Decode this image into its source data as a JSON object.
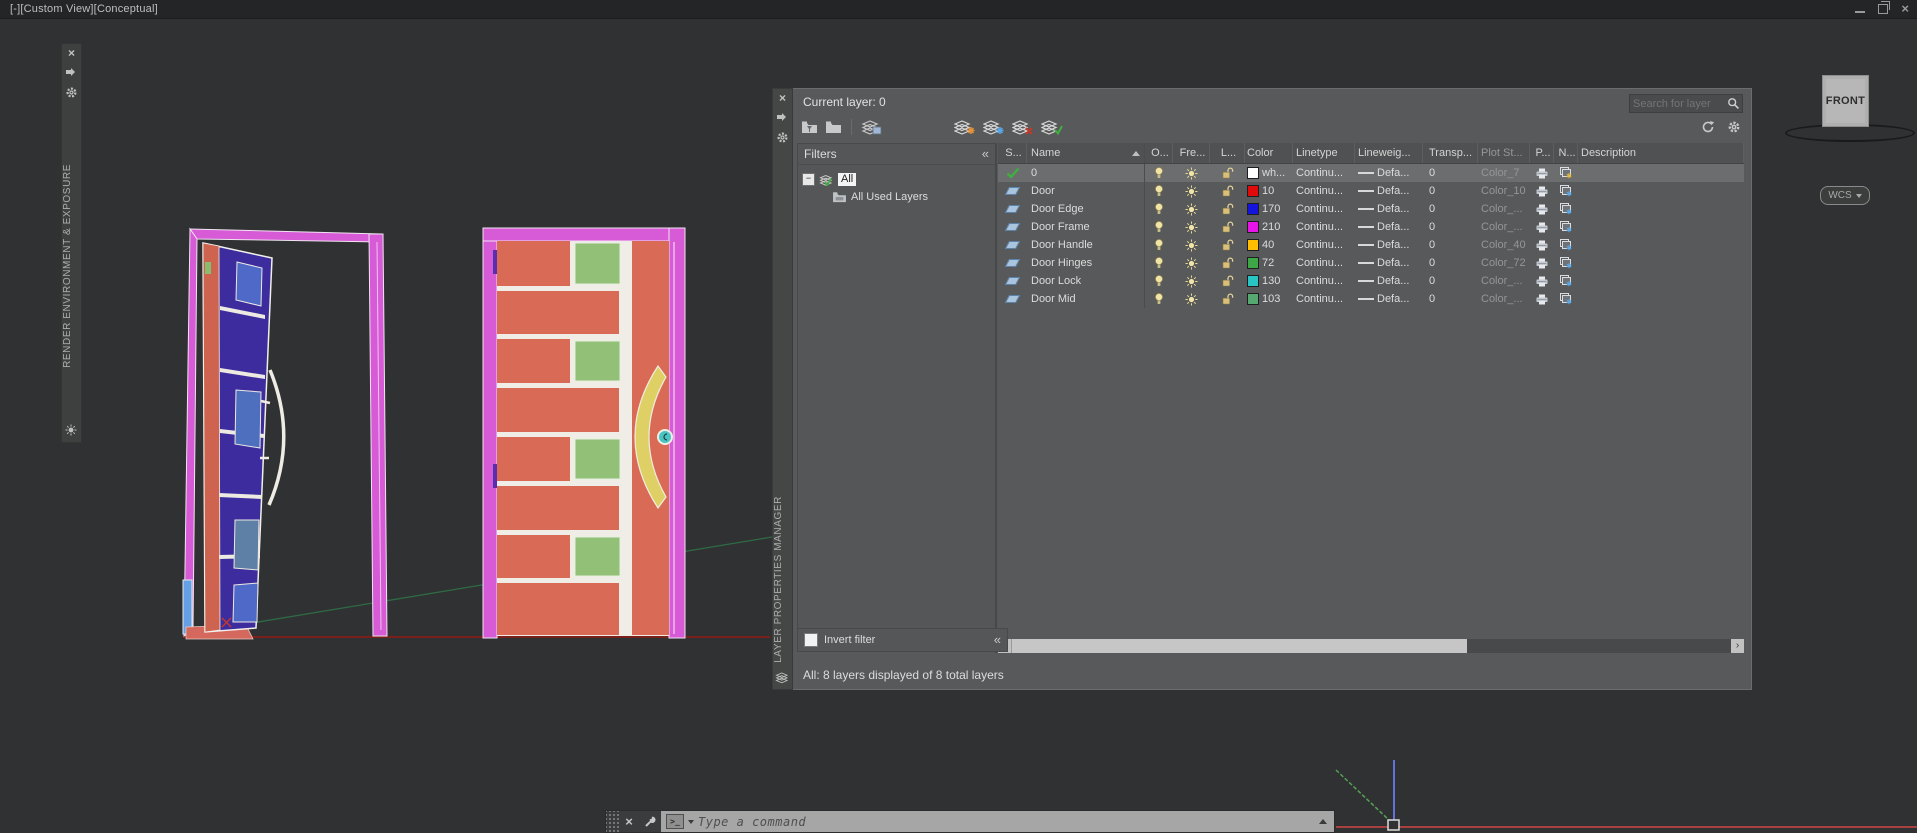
{
  "window": {
    "view_controls_label": "[-][Custom View][Conceptual]"
  },
  "viewport": {
    "left_toolbar_title": "RENDER ENVIRONMENT & EXPOSURE",
    "viewcube": {
      "face": "FRONT",
      "wcs_label": "WCS"
    }
  },
  "palette": {
    "title": "LAYER PROPERTIES MANAGER",
    "current_layer_label": "Current layer: 0",
    "search_placeholder": "Search for layer",
    "filters": {
      "header": "Filters",
      "root": "All",
      "child": "All Used Layers",
      "invert_label": "Invert filter"
    },
    "status_text": "All: 8 layers displayed of 8 total layers",
    "table": {
      "columns": [
        "S...",
        "Name",
        "O...",
        "Fre...",
        "L...",
        "Color",
        "Linetype",
        "Lineweig...",
        "Transp...",
        "Plot St...",
        "P...",
        "N...",
        "Description"
      ],
      "rows": [
        {
          "name": "0",
          "current": true,
          "color_label": "wh...",
          "color_hex": "#FFFFFF",
          "linetype": "Continu...",
          "lineweight": "Defa...",
          "transparency": "0",
          "plot_style": "Color_7"
        },
        {
          "name": "Door",
          "current": false,
          "color_label": "10",
          "color_hex": "#E00A0A",
          "linetype": "Continu...",
          "lineweight": "Defa...",
          "transparency": "0",
          "plot_style": "Color_10"
        },
        {
          "name": "Door Edge",
          "current": false,
          "color_label": "170",
          "color_hex": "#1414DC",
          "linetype": "Continu...",
          "lineweight": "Defa...",
          "transparency": "0",
          "plot_style": "Color_..."
        },
        {
          "name": "Door Frame",
          "current": false,
          "color_label": "210",
          "color_hex": "#E814E8",
          "linetype": "Continu...",
          "lineweight": "Defa...",
          "transparency": "0",
          "plot_style": "Color_..."
        },
        {
          "name": "Door Handle",
          "current": false,
          "color_label": "40",
          "color_hex": "#FFBE00",
          "linetype": "Continu...",
          "lineweight": "Defa...",
          "transparency": "0",
          "plot_style": "Color_40"
        },
        {
          "name": "Door Hinges",
          "current": false,
          "color_label": "72",
          "color_hex": "#3FA647",
          "linetype": "Continu...",
          "lineweight": "Defa...",
          "transparency": "0",
          "plot_style": "Color_72"
        },
        {
          "name": "Door Lock",
          "current": false,
          "color_label": "130",
          "color_hex": "#29C5C5",
          "linetype": "Continu...",
          "lineweight": "Defa...",
          "transparency": "0",
          "plot_style": "Color_..."
        },
        {
          "name": "Door Mid",
          "current": false,
          "color_label": "103",
          "color_hex": "#55A870",
          "linetype": "Continu...",
          "lineweight": "Defa...",
          "transparency": "0",
          "plot_style": "Color_..."
        }
      ]
    }
  },
  "command_line": {
    "placeholder": "Type a command"
  },
  "icons": {
    "close": "x-glyph",
    "minimize": "bar-glyph",
    "restore": "double-square-glyph",
    "collapse_left": "«",
    "search": "magnifier",
    "refresh": "circular-arrows",
    "settings": "gear",
    "sort_ascending": "triangle-up"
  },
  "colors": {
    "frame_magenta": "#D75AD7",
    "door_salmon": "#D96A55",
    "door_green": "#92C077",
    "door_purple": "#3D2C9E",
    "handle_yellow": "#DFD066",
    "lock_cyan": "#49C4C4",
    "axis_red": "#A84040",
    "axis_green": "#57A057",
    "axis_blue": "#6272D8"
  }
}
